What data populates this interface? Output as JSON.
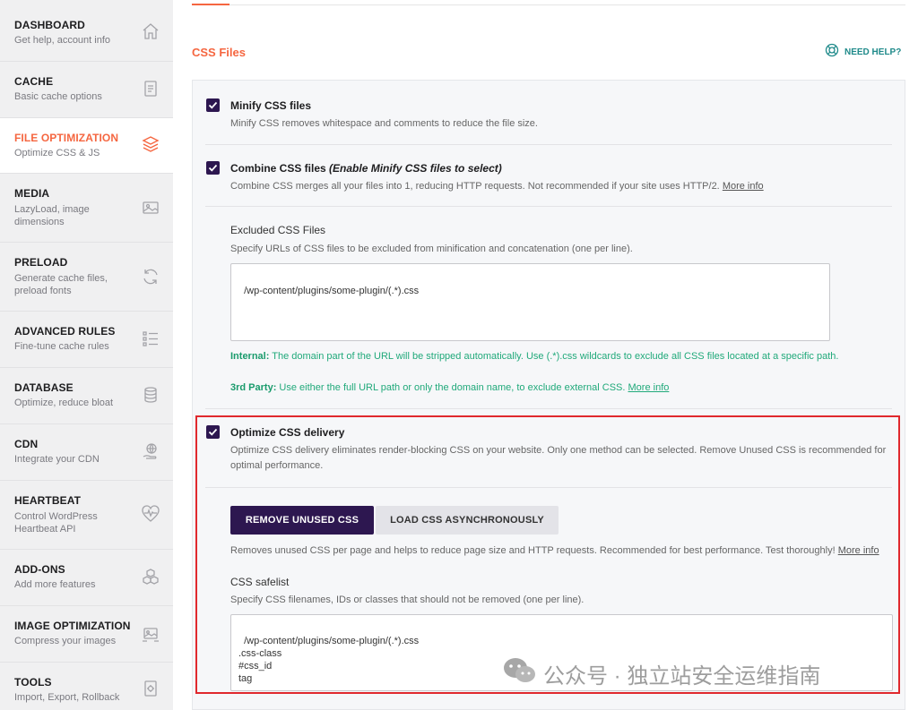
{
  "sidebar": {
    "items": [
      {
        "title": "DASHBOARD",
        "subtitle": "Get help, account info",
        "icon": "home-icon",
        "active": false
      },
      {
        "title": "CACHE",
        "subtitle": "Basic cache options",
        "icon": "document-icon",
        "active": false
      },
      {
        "title": "FILE OPTIMIZATION",
        "subtitle": "Optimize CSS & JS",
        "icon": "layers-icon",
        "active": true
      },
      {
        "title": "MEDIA",
        "subtitle": "LazyLoad, image dimensions",
        "icon": "image-icon",
        "active": false
      },
      {
        "title": "PRELOAD",
        "subtitle": "Generate cache files, preload fonts",
        "icon": "refresh-icon",
        "active": false
      },
      {
        "title": "ADVANCED RULES",
        "subtitle": "Fine-tune cache rules",
        "icon": "list-icon",
        "active": false
      },
      {
        "title": "DATABASE",
        "subtitle": "Optimize, reduce bloat",
        "icon": "database-icon",
        "active": false
      },
      {
        "title": "CDN",
        "subtitle": "Integrate your CDN",
        "icon": "globe-hand-icon",
        "active": false
      },
      {
        "title": "HEARTBEAT",
        "subtitle": "Control WordPress Heartbeat API",
        "icon": "heartbeat-icon",
        "active": false
      },
      {
        "title": "ADD-ONS",
        "subtitle": "Add more features",
        "icon": "cubes-icon",
        "active": false
      },
      {
        "title": "IMAGE OPTIMIZATION",
        "subtitle": "Compress your images",
        "icon": "image-optimize-icon",
        "active": false
      },
      {
        "title": "TOOLS",
        "subtitle": "Import, Export, Rollback",
        "icon": "tools-icon",
        "active": false
      }
    ]
  },
  "header": {
    "section_title": "CSS Files",
    "help_label": "NEED HELP?"
  },
  "options": {
    "minify": {
      "label": "Minify CSS files",
      "description": "Minify CSS removes whitespace and comments to reduce the file size.",
      "checked": true
    },
    "combine": {
      "label": "Combine CSS files",
      "label_note": "(Enable Minify CSS files to select)",
      "description": "Combine CSS merges all your files into 1, reducing HTTP requests. Not recommended if your site uses HTTP/2.",
      "more_info": "More info",
      "checked": true
    },
    "excluded": {
      "label": "Excluded CSS Files",
      "description": "Specify URLs of CSS files to be excluded from minification and concatenation (one per line).",
      "value": "/wp-content/plugins/some-plugin/(.*).css",
      "note_internal_label": "Internal:",
      "note_internal_text": "The domain part of the URL will be stripped automatically. Use (.*).css wildcards to exclude all CSS files located at a specific path.",
      "note_third_label": "3rd Party:",
      "note_third_text": "Use either the full URL path or only the domain name, to exclude external CSS.",
      "note_more_info": "More info"
    },
    "optimize_delivery": {
      "label": "Optimize CSS delivery",
      "description": "Optimize CSS delivery eliminates render-blocking CSS on your website. Only one method can be selected. Remove Unused CSS is recommended for optimal performance.",
      "checked": true,
      "btn_remove_unused": "REMOVE UNUSED CSS",
      "btn_load_async": "LOAD CSS ASYNCHRONOUSLY",
      "method_description": "Removes unused CSS per page and helps to reduce page size and HTTP requests. Recommended for best performance. Test thoroughly!",
      "method_more_info": "More info",
      "safelist_label": "CSS safelist",
      "safelist_description": "Specify CSS filenames, IDs or classes that should not be removed (one per line).",
      "safelist_value": "/wp-content/plugins/some-plugin/(.*).css\n.css-class\n#css_id\ntag"
    }
  },
  "watermark": {
    "text": "公众号 · 独立站安全运维指南"
  },
  "colors": {
    "accent": "#f56640",
    "primary_button": "#2d1750",
    "checkbox": "#2d1750",
    "note_green": "#20a97a",
    "help_teal": "#1f8a8a",
    "highlight_red": "#e0282d"
  }
}
